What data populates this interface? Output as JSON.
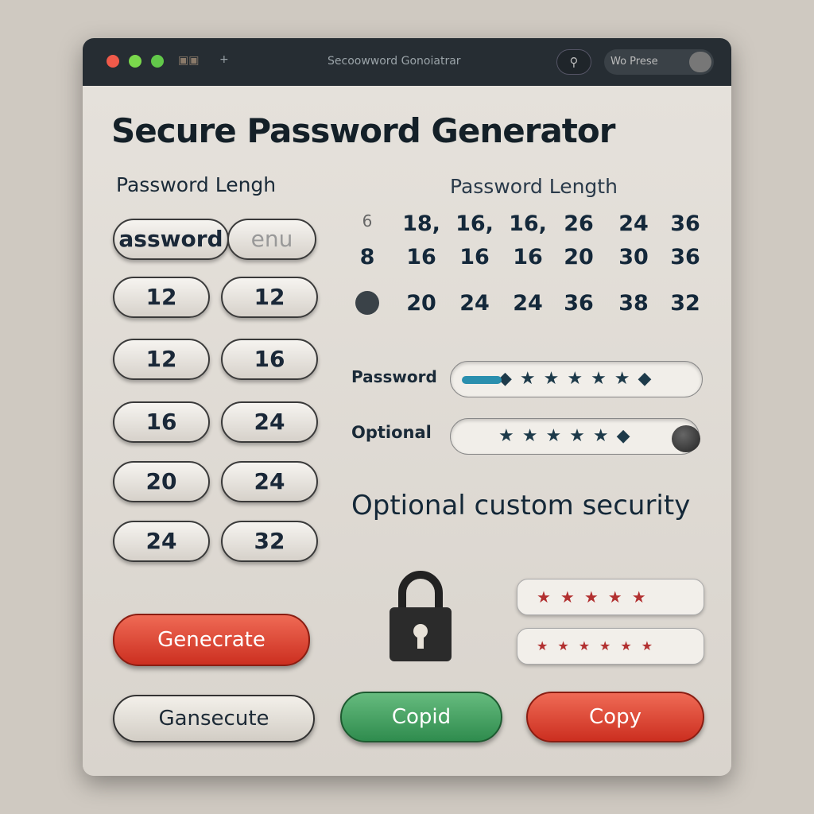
{
  "window": {
    "title": "Secoowword Gonoiatrar",
    "toggle_label": "Wo Prese"
  },
  "heading": "Secure Password Generator",
  "left": {
    "label": "Password Lengh",
    "top_pills": [
      "assword",
      "enu"
    ],
    "pills": [
      [
        "12",
        "12"
      ],
      [
        "12",
        "16"
      ],
      [
        "16",
        "24"
      ],
      [
        "20",
        "24"
      ],
      [
        "24",
        "32"
      ]
    ],
    "generate": "Genecrate",
    "execute": "Gansecute"
  },
  "right": {
    "label": "Password Length",
    "grid": [
      [
        "6",
        "18,",
        "16,",
        "16,",
        "26",
        "24",
        "36"
      ],
      [
        "8",
        "16",
        "16",
        "16",
        "20",
        "30",
        "36"
      ],
      [
        "",
        "20",
        "24",
        "24",
        "36",
        "38",
        "32"
      ]
    ],
    "password_label": "Password",
    "password_value": "◆★★★★★◆",
    "optional_label": "Optional",
    "optional_value": "★★★★★◆",
    "custom": "Optional custom security",
    "stars1": "★★★★★",
    "stars2": "★★★★★★",
    "copid": "Copid",
    "copy": "Copy"
  },
  "colors": {
    "titlebar": "#262d33",
    "red": "#d9402e",
    "green": "#3f9a5c"
  }
}
